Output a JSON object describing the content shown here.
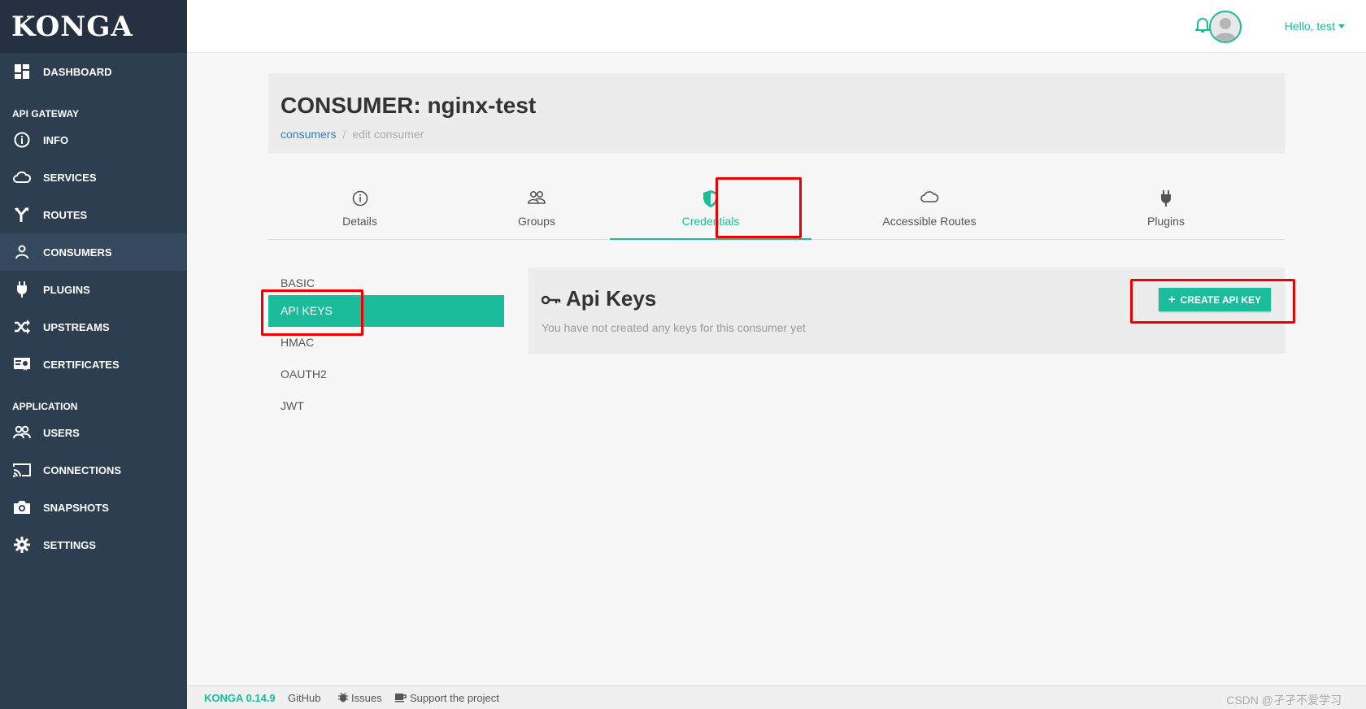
{
  "sidebar": {
    "logo": "KONGA",
    "dashboard": "DASHBOARD",
    "section_api": "API GATEWAY",
    "api_items": [
      "INFO",
      "SERVICES",
      "ROUTES",
      "CONSUMERS",
      "PLUGINS",
      "UPSTREAMS",
      "CERTIFICATES"
    ],
    "section_app": "APPLICATION",
    "app_items": [
      "USERS",
      "CONNECTIONS",
      "SNAPSHOTS",
      "SETTINGS"
    ],
    "active": "CONSUMERS"
  },
  "topbar": {
    "greeting": "Hello, test"
  },
  "header": {
    "title": "CONSUMER: nginx-test",
    "breadcrumb": [
      "consumers",
      "edit consumer"
    ]
  },
  "tabs": [
    "Details",
    "Groups",
    "Credentials",
    "Accessible Routes",
    "Plugins"
  ],
  "active_tab": "Credentials",
  "credential_types": [
    "BASIC",
    "API KEYS",
    "HMAC",
    "OAUTH2",
    "JWT"
  ],
  "active_credential": "API KEYS",
  "apikeys": {
    "title": "Api Keys",
    "empty_message": "You have not created any keys for this consumer yet",
    "create_button": "CREATE API KEY"
  },
  "footer": {
    "version": "KONGA 0.14.9",
    "github": "GitHub",
    "issues": "Issues",
    "support": "Support the project",
    "watermark": "CSDN @孑孑不爱学习"
  },
  "colors": {
    "accent": "#1abc9c",
    "sidebar": "#2c3e50",
    "highlight": "#e00000"
  }
}
